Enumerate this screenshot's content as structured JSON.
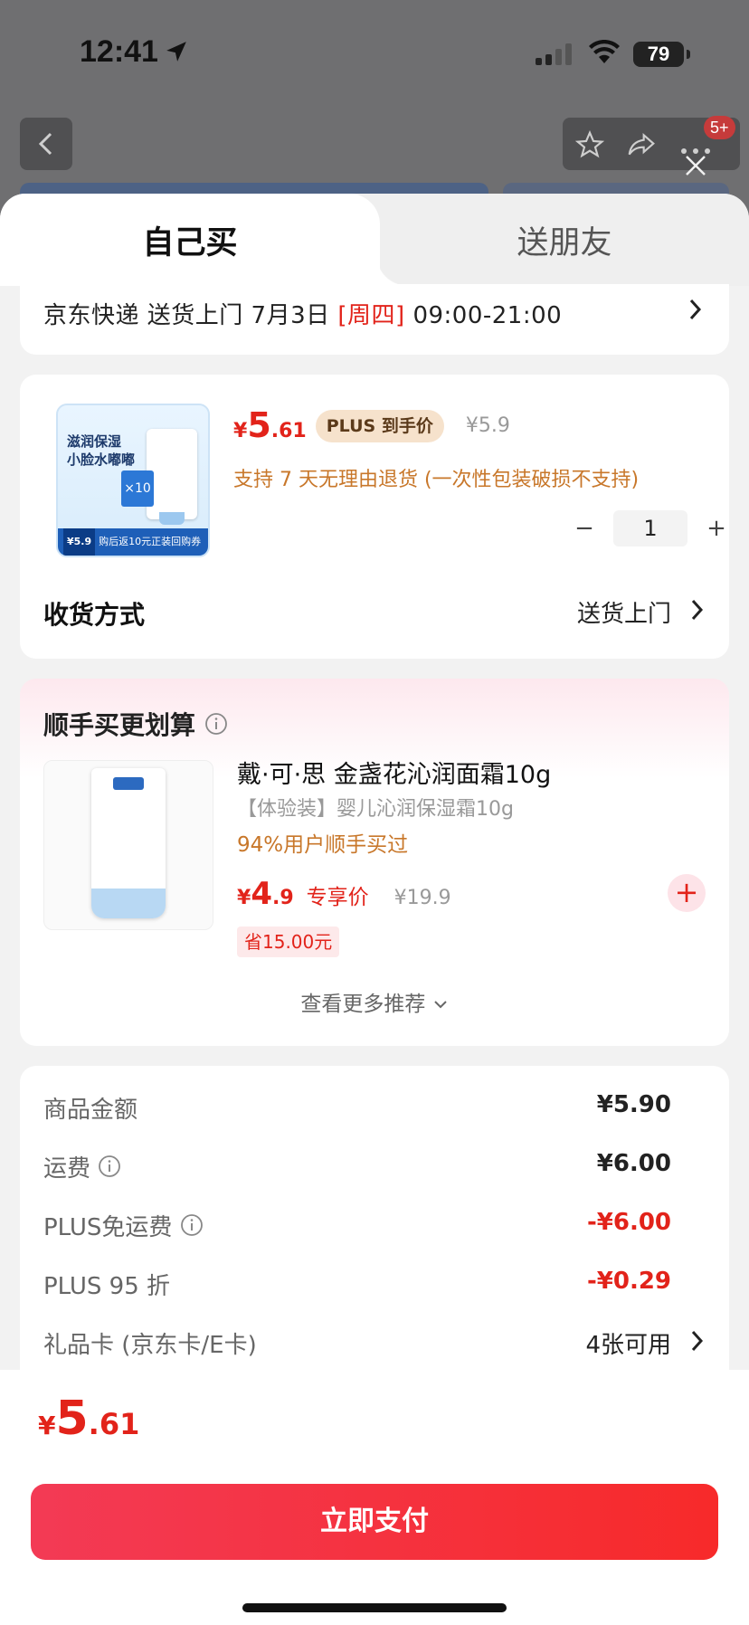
{
  "status_bar": {
    "time": "12:41",
    "battery": "79"
  },
  "background": {
    "badge": "5+"
  },
  "tabs": {
    "active": "自己买",
    "inactive": "送朋友"
  },
  "delivery": {
    "prefix": "京东快递 送货上门 7月3日 ",
    "weekday": "[周四]",
    "time_range": " 09:00-21:00"
  },
  "product": {
    "image": {
      "title_line1": "滋润保湿",
      "title_line2": "小脸水嘟嘟",
      "box_badge": "×10",
      "footer_price": "¥5.9",
      "footer_text": "购后返10元正装回购券"
    },
    "price_symbol": "¥",
    "price_int": "5",
    "price_dec": ".61",
    "plus_tag": "PLUS 到手价",
    "original_price": "¥5.9",
    "return_policy": "支持 7 天无理由退货 (一次性包装破损不支持)",
    "quantity": "1",
    "minus": "−",
    "plus": "+",
    "ship_label": "收货方式",
    "ship_value": "送货上门"
  },
  "recommend": {
    "title": "顺手买更划算",
    "item": {
      "name": "戴·可·思 金盏花沁润面霜10g",
      "spec": "【体验装】婴儿沁润保湿霜10g",
      "buy_rate": "94%用户顺手买过",
      "price_symbol": "¥",
      "price_int": "4",
      "price_dec": ".9",
      "exclusive_label": "专享价",
      "original_price": "¥19.9",
      "save": "省15.00元",
      "add": "+"
    },
    "more": "查看更多推荐"
  },
  "summary": {
    "rows": [
      {
        "label": "商品金额",
        "value": "¥5.90"
      },
      {
        "label": "运费",
        "value": "¥6.00"
      },
      {
        "label": "PLUS免运费",
        "value": "-¥6.00"
      },
      {
        "label": "PLUS 95 折",
        "value": "-¥0.29"
      },
      {
        "label": "礼品卡 (京东卡/E卡)",
        "value": "4张可用"
      }
    ]
  },
  "footer": {
    "total_symbol": "¥",
    "total_int": "5",
    "total_dec": ".61",
    "pay_button": "立即支付"
  },
  "colors": {
    "accent": "#e2231a",
    "orange": "#c8772a",
    "plus_tag_bg": "#f6e2cc"
  }
}
